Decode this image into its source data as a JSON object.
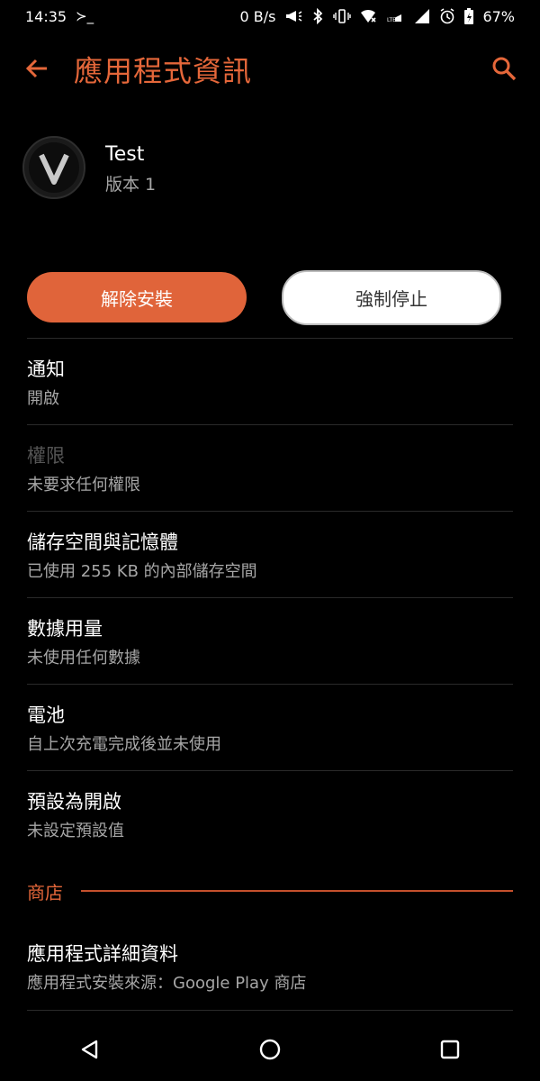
{
  "status_bar": {
    "time": "14:35",
    "terminal": "≻_",
    "net_speed": "0 B/s",
    "battery": "67%",
    "icons": [
      "megaphone-icon",
      "bluetooth-icon",
      "vibrate-icon",
      "wifi-off-icon",
      "volte-icon",
      "signal-icon",
      "alarm-icon",
      "battery-charging-icon"
    ]
  },
  "toolbar": {
    "title": "應用程式資訊",
    "back_icon": "arrow-left-icon",
    "search_icon": "search-icon"
  },
  "app": {
    "name": "Test",
    "version": "版本 1",
    "icon": "v-logo-icon"
  },
  "buttons": {
    "uninstall": "解除安裝",
    "force_stop": "強制停止"
  },
  "settings": {
    "items": [
      {
        "title": "通知",
        "subtitle": "開啟"
      },
      {
        "title": "權限",
        "subtitle": "未要求任何權限"
      },
      {
        "title": "儲存空間與記憶體",
        "subtitle": "已使用 255 KB 的內部儲存空間"
      },
      {
        "title": "數據用量",
        "subtitle": "未使用任何數據"
      },
      {
        "title": "電池",
        "subtitle": "自上次充電完成後並未使用"
      },
      {
        "title": "預設為開啟",
        "subtitle": "未設定預設值"
      }
    ]
  },
  "store": {
    "header": "商店",
    "item": {
      "title": "應用程式詳細資料",
      "subtitle": "應用程式安裝來源：Google Play 商店"
    }
  },
  "colors": {
    "accent": "#e5673a",
    "background": "#000000"
  }
}
